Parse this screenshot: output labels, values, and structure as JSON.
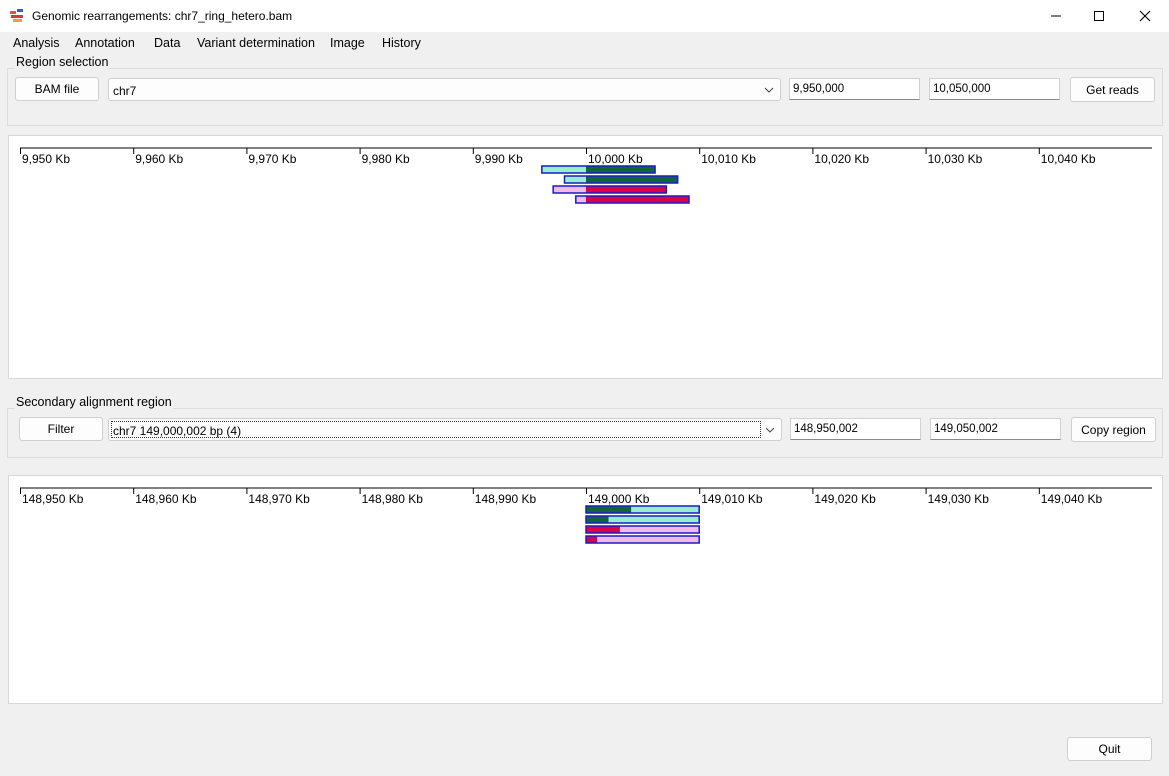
{
  "window": {
    "title": "Genomic rearrangements: chr7_ring_hetero.bam",
    "minimize_icon": "minimize-icon",
    "maximize_icon": "maximize-icon",
    "close_icon": "close-icon"
  },
  "menu": [
    {
      "label": "Analysis"
    },
    {
      "label": "Annotation"
    },
    {
      "label": "Data"
    },
    {
      "label": "Variant determination"
    },
    {
      "label": "Image"
    },
    {
      "label": "History"
    }
  ],
  "region_selection": {
    "group_label": "Region selection",
    "bam_button": "BAM file",
    "chromosome": "chr7",
    "start": "9,950,000",
    "end": "10,050,000",
    "get_reads_button": "Get reads"
  },
  "primary_plot": {
    "ticks": [
      "9,950 Kb",
      "9,960 Kb",
      "9,970 Kb",
      "9,980 Kb",
      "9,990 Kb",
      "10,000 Kb",
      "10,010 Kb",
      "10,020 Kb",
      "10,030 Kb",
      "10,040 Kb"
    ],
    "range_kb": [
      9950,
      10050
    ],
    "reads": [
      {
        "start_kb": 9996.1,
        "split_kb": 10000.0,
        "end_kb": 10006.1,
        "light": "#99eecc",
        "dark": "#116633"
      },
      {
        "start_kb": 9998.1,
        "split_kb": 10000.0,
        "end_kb": 10008.1,
        "light": "#99eecc",
        "dark": "#116633"
      },
      {
        "start_kb": 9997.1,
        "split_kb": 10000.0,
        "end_kb": 10007.1,
        "light": "#f2bbe6",
        "dark": "#dd0044"
      },
      {
        "start_kb": 9999.1,
        "split_kb": 10000.0,
        "end_kb": 10009.1,
        "light": "#f2bbe6",
        "dark": "#dd0044"
      }
    ]
  },
  "secondary_region": {
    "group_label": "Secondary alignment region",
    "filter_button": "Filter",
    "region": "chr7 149,000,002 bp (4)",
    "start": "148,950,002",
    "end": "149,050,002",
    "copy_button": "Copy region"
  },
  "secondary_plot": {
    "ticks": [
      "148,950 Kb",
      "148,960 Kb",
      "148,970 Kb",
      "148,980 Kb",
      "148,990 Kb",
      "149,000 Kb",
      "149,010 Kb",
      "149,020 Kb",
      "149,030 Kb",
      "149,040 Kb"
    ],
    "range_kb": [
      148950,
      149050
    ],
    "reads": [
      {
        "start_kb": 149000.0,
        "split_kb": 149004.0,
        "end_kb": 149010.0,
        "dark": "#116633",
        "light": "#99eecc"
      },
      {
        "start_kb": 149000.0,
        "split_kb": 149002.0,
        "end_kb": 149010.0,
        "dark": "#116633",
        "light": "#99eecc"
      },
      {
        "start_kb": 149000.0,
        "split_kb": 149003.0,
        "end_kb": 149010.0,
        "dark": "#dd0044",
        "light": "#f2bbe6"
      },
      {
        "start_kb": 149000.0,
        "split_kb": 149001.0,
        "end_kb": 149010.0,
        "dark": "#dd0044",
        "light": "#f2bbe6"
      }
    ]
  },
  "quit_button": "Quit",
  "colors": {
    "read_border": "#1a1acc",
    "axis": "#000000"
  }
}
